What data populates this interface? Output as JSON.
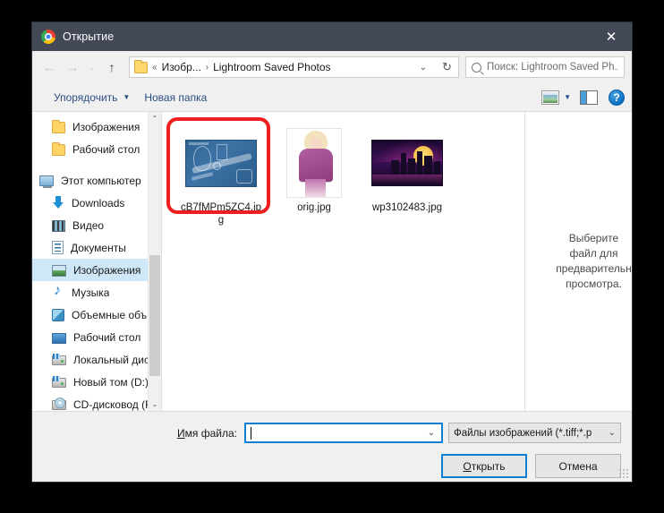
{
  "window": {
    "title": "Открытие",
    "title_icon": "chrome-icon",
    "close_label": "✕",
    "titlebar_color": "#434857"
  },
  "nav": {
    "back": "←",
    "forward": "→",
    "recent": "⌄",
    "up": "↑",
    "refresh": "↻",
    "breadcrumb": {
      "overflow": "«",
      "items": [
        "Изобр...",
        "Lightroom Saved Photos"
      ],
      "separator": "›",
      "chevron": "⌄"
    },
    "search": {
      "placeholder": "Поиск: Lightroom Saved Ph...",
      "icon": "search-icon"
    }
  },
  "toolbar": {
    "organize_label": "Упорядочить",
    "organize_caret": "▼",
    "new_folder_label": "Новая папка",
    "view_caret": "▼",
    "view_icon": "view-mode-icon",
    "pane_icon": "preview-pane-icon",
    "help_label": "?"
  },
  "sidebar": {
    "groups": [
      {
        "items": [
          {
            "label": "Изображения",
            "icon": "folder-icon",
            "type": "folder",
            "indent": true,
            "selected": false
          },
          {
            "label": "Рабочий стол",
            "icon": "folder-icon",
            "type": "folder",
            "indent": true,
            "selected": false
          }
        ]
      },
      {
        "items": [
          {
            "label": "Этот компьютер",
            "icon": "computer-icon",
            "type": "pc",
            "indent": false,
            "selected": false
          },
          {
            "label": "Downloads",
            "icon": "downloads-icon",
            "type": "dl",
            "indent": true,
            "selected": false
          },
          {
            "label": "Видео",
            "icon": "video-icon",
            "type": "video",
            "indent": true,
            "selected": false
          },
          {
            "label": "Документы",
            "icon": "documents-icon",
            "type": "doc",
            "indent": true,
            "selected": false
          },
          {
            "label": "Изображения",
            "icon": "pictures-icon",
            "type": "pic",
            "indent": true,
            "selected": true
          },
          {
            "label": "Музыка",
            "icon": "music-icon",
            "type": "music",
            "indent": true,
            "selected": false
          },
          {
            "label": "Объемные объ",
            "icon": "3d-objects-icon",
            "type": "3d",
            "indent": true,
            "selected": false
          },
          {
            "label": "Рабочий стол",
            "icon": "desktop-icon",
            "type": "desk",
            "indent": true,
            "selected": false
          },
          {
            "label": "Локальный дис",
            "icon": "local-disk-icon",
            "type": "drive",
            "indent": true,
            "selected": false
          },
          {
            "label": "Новый том (D:)",
            "icon": "drive-icon",
            "type": "drive",
            "indent": true,
            "selected": false
          },
          {
            "label": "CD-дисковод (F:",
            "icon": "cd-drive-icon",
            "type": "cd",
            "indent": true,
            "selected": false
          }
        ]
      }
    ],
    "scrollbar": {
      "up": "⌃",
      "down": "⌄"
    }
  },
  "files": [
    {
      "name": "cB7fMPm5ZC4.jpg",
      "thumb": "blueprint",
      "selected": true,
      "annotated": true
    },
    {
      "name": "orig.jpg",
      "thumb": "girl",
      "selected": false,
      "annotated": false
    },
    {
      "name": "wp3102483.jpg",
      "thumb": "city",
      "selected": false,
      "annotated": false
    }
  ],
  "preview": {
    "lines": [
      "Выберите",
      "файл для",
      "предварительн",
      "просмотра."
    ]
  },
  "footer": {
    "filename_label_prefix": "И",
    "filename_label_rest": "мя файла:",
    "filename_value": "",
    "filename_chevron": "⌄",
    "filetype_value": "Файлы изображений (*.tiff;*.p",
    "filetype_chevron": "⌄",
    "open_prefix": "О",
    "open_rest": "ткрыть",
    "cancel_label": "Отмена"
  },
  "colors": {
    "titlebar": "#434857",
    "accent": "#0f7fd4",
    "selection": "#cfe8f7",
    "annotation": "#f01e1e",
    "link": "#2c4f82"
  }
}
